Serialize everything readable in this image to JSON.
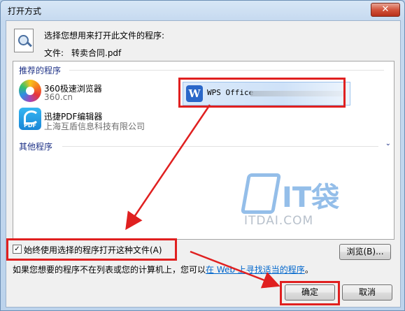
{
  "window": {
    "title": "打开方式",
    "close_symbol": "✕"
  },
  "dialog": {
    "prompt": "选择您想用来打开此文件的程序:",
    "file_label": "文件:",
    "file_name": "转卖合同.pdf"
  },
  "recommended": {
    "header": "推荐的程序",
    "programs": [
      {
        "name": "360极速浏览器",
        "publisher": "360.cn",
        "icon": "360-browser-icon"
      },
      {
        "name": "迅捷PDF编辑器",
        "publisher": "上海互盾信息科技有限公司",
        "icon": "pdf-editor-icon",
        "icon_text": "PDF"
      },
      {
        "name": "WPS Office",
        "icon": "wps-icon",
        "icon_text": "W",
        "selected": true
      }
    ]
  },
  "other": {
    "header": "其他程序",
    "expand_symbol": "⌄"
  },
  "watermark": {
    "logo_text": "IT袋",
    "url": "ITDAI.COM"
  },
  "options": {
    "always_use_label": "始终使用选择的程序打开这种文件(A)",
    "always_use_checked": true,
    "check_symbol": "✓"
  },
  "buttons": {
    "browse": "浏览(B)...",
    "ok": "确定",
    "cancel": "取消"
  },
  "info": {
    "text_before": "如果您想要的程序不在列表或您的计算机上，您可以",
    "link": "在 Web 上寻找适当的程序",
    "text_after": "。"
  },
  "colors": {
    "highlight_box": "#e02020",
    "link": "#0066cc",
    "header_text": "#1e3287"
  }
}
